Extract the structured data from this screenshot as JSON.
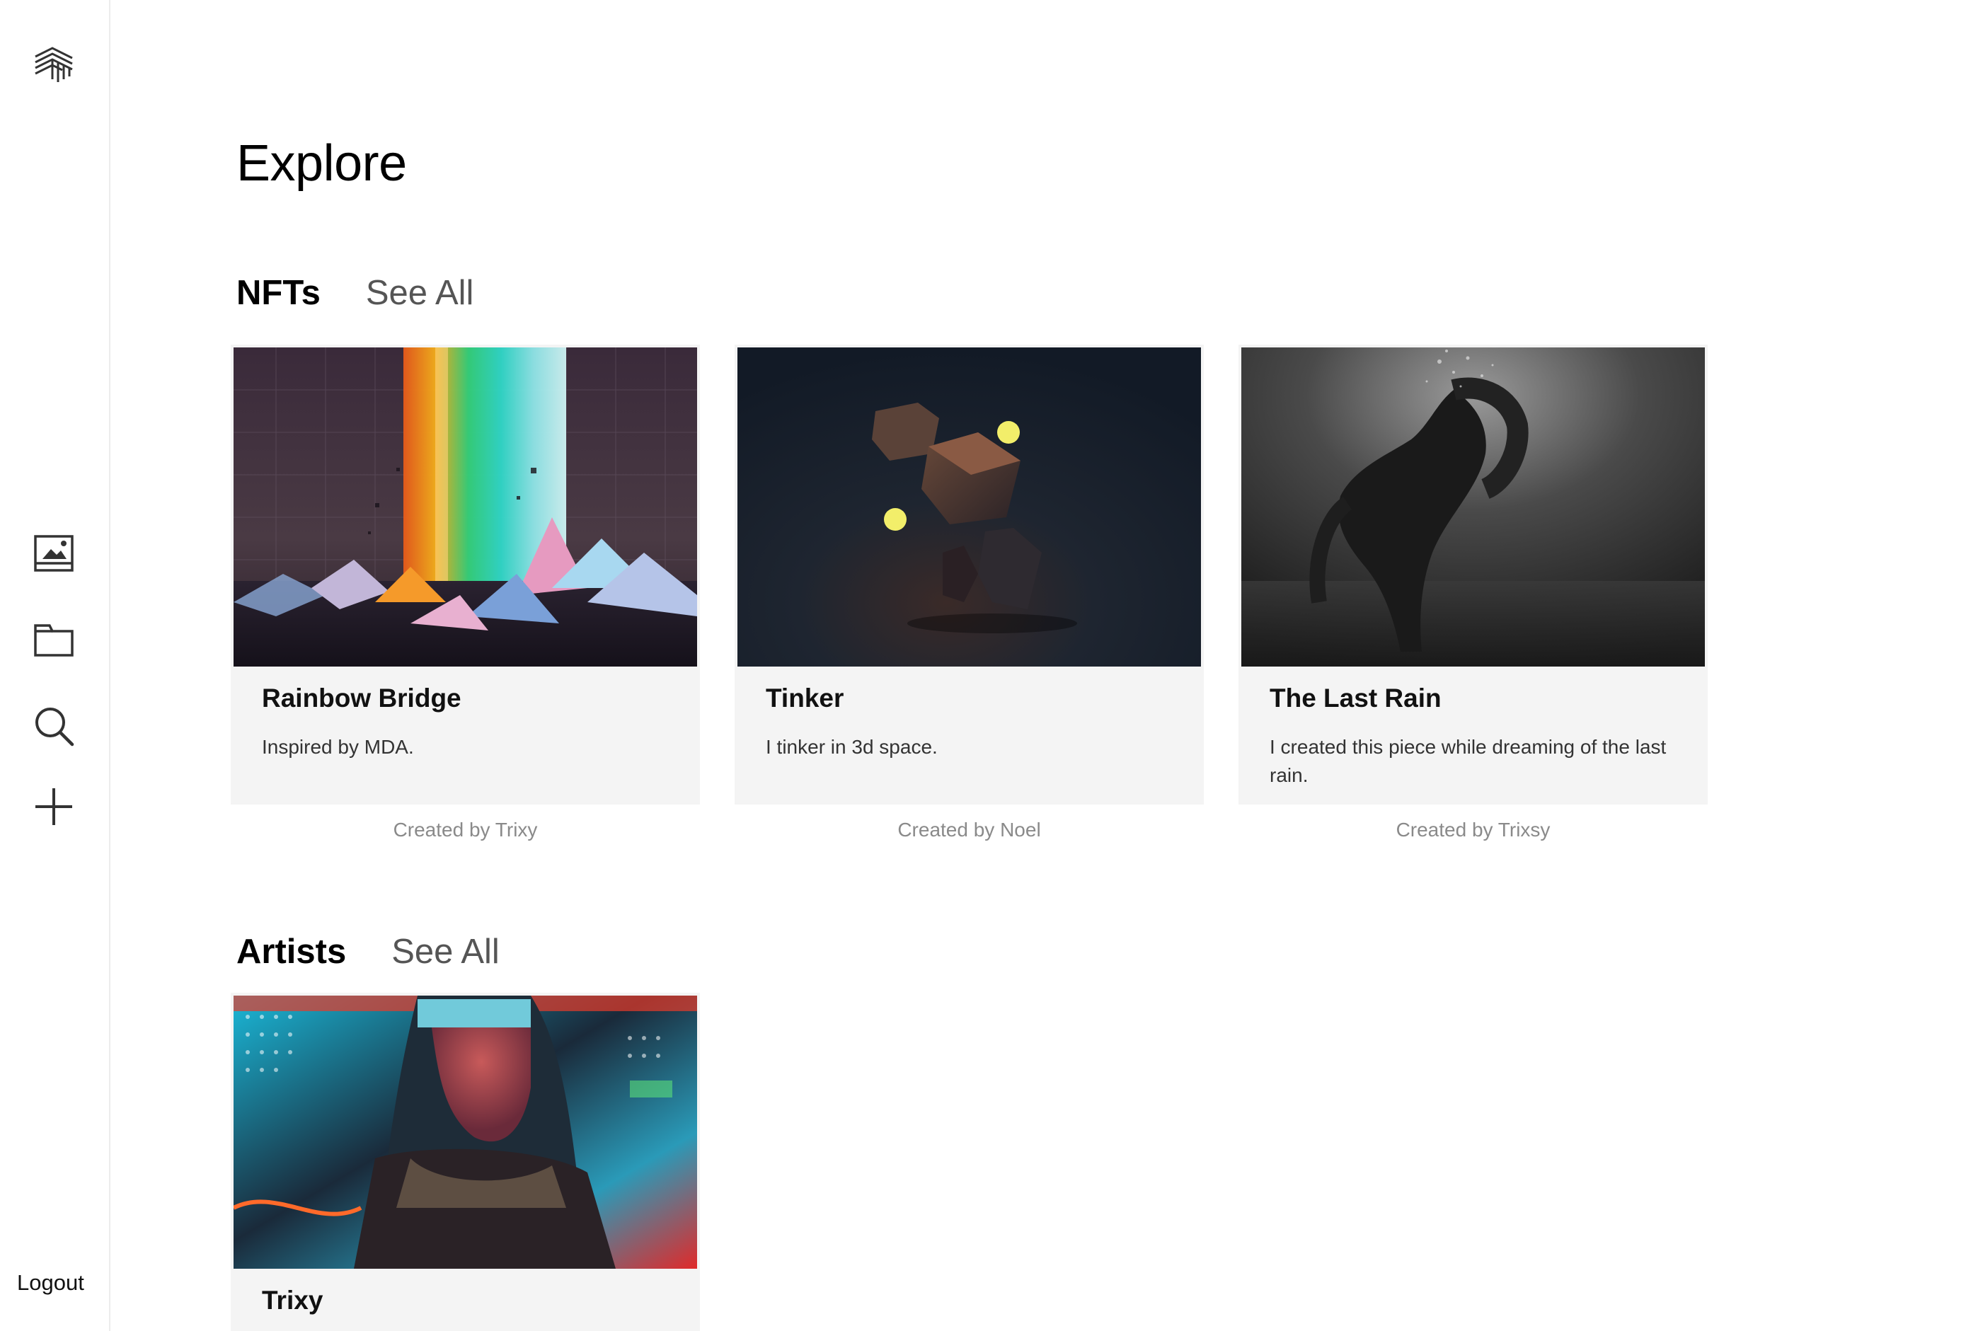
{
  "sidebar": {
    "logo_icon": "layered-stripes-logo",
    "nav": [
      {
        "icon": "image-icon"
      },
      {
        "icon": "folder-icon"
      },
      {
        "icon": "search-icon"
      },
      {
        "icon": "plus-icon"
      }
    ],
    "logout_label": "Logout"
  },
  "page": {
    "title": "Explore"
  },
  "nfts": {
    "heading": "NFTs",
    "see_all": "See All",
    "items": [
      {
        "title": "Rainbow Bridge",
        "description": "Inspired by MDA.",
        "creator": "Created by Trixy"
      },
      {
        "title": "Tinker",
        "description": "I tinker in 3d space.",
        "creator": "Created by Noel"
      },
      {
        "title": "The Last Rain",
        "description": "I created this piece while dreaming of the last rain.",
        "creator": "Created by Trixsy"
      }
    ]
  },
  "artists": {
    "heading": "Artists",
    "see_all": "See All",
    "items": [
      {
        "name": "Trixy"
      }
    ]
  }
}
